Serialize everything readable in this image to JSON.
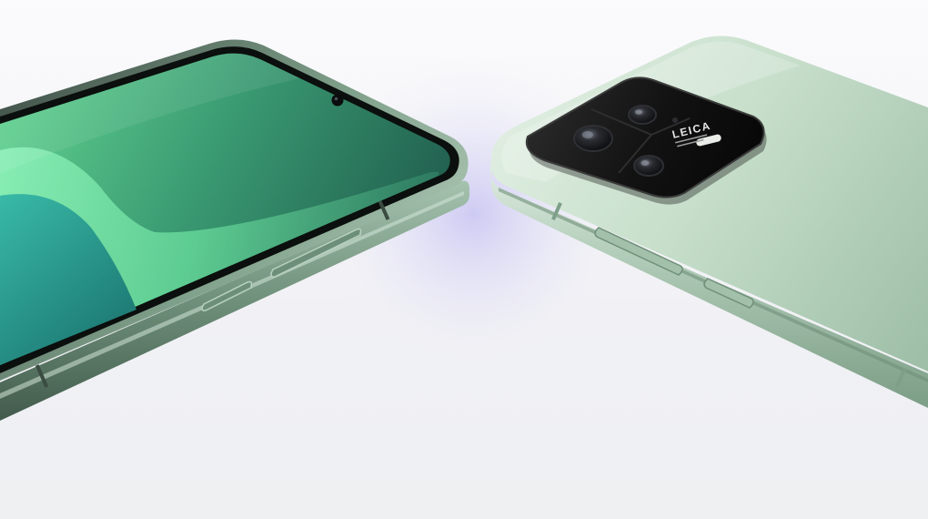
{
  "scene": {
    "description_colors": {
      "background": "#f4f4f7",
      "glow": "#c9c6f2",
      "screen_dark": "#1f5b4c",
      "screen_light": "#7fe0a5",
      "screen_teal": "#2aa79a",
      "frame": "#6d8f7a",
      "back_light": "#d7e9d9",
      "back_mid": "#a7c8b0",
      "camera_module": "#151515"
    },
    "camera": {
      "brand_logo": "LEICA"
    }
  }
}
